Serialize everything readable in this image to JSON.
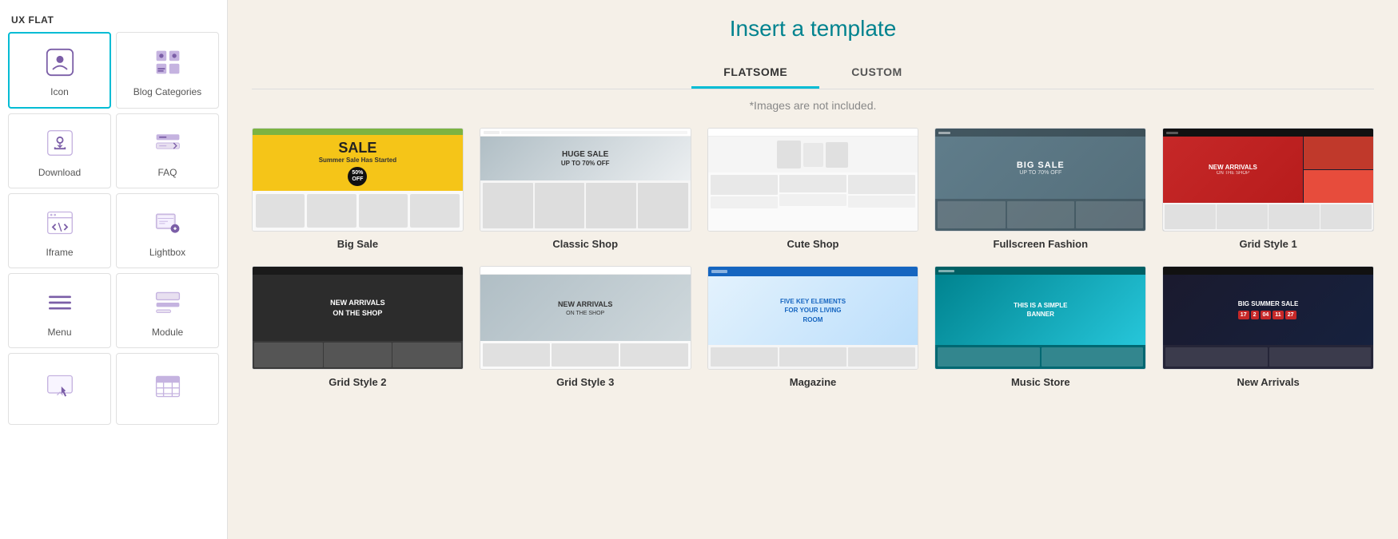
{
  "sidebar": {
    "title": "UX FLAT",
    "items": [
      {
        "id": "icon",
        "label": "Icon",
        "active": true
      },
      {
        "id": "blog-categories",
        "label": "Blog Categories",
        "active": false
      },
      {
        "id": "download",
        "label": "Download",
        "active": false
      },
      {
        "id": "faq",
        "label": "FAQ",
        "active": false
      },
      {
        "id": "iframe",
        "label": "Iframe",
        "active": false
      },
      {
        "id": "lightbox",
        "label": "Lightbox",
        "active": false
      },
      {
        "id": "menu",
        "label": "Menu",
        "active": false
      },
      {
        "id": "module",
        "label": "Module",
        "active": false
      },
      {
        "id": "cursor",
        "label": "",
        "active": false
      },
      {
        "id": "table",
        "label": "",
        "active": false
      }
    ]
  },
  "main": {
    "title": "Insert a template",
    "tabs": [
      {
        "id": "flatsome",
        "label": "FLATSOME",
        "active": true
      },
      {
        "id": "custom",
        "label": "CUSTOM",
        "active": false
      }
    ],
    "subtitle": "*Images are not included.",
    "templates_row1": [
      {
        "id": "big-sale",
        "name": "Big Sale"
      },
      {
        "id": "classic-shop",
        "name": "Classic Shop"
      },
      {
        "id": "cute-shop",
        "name": "Cute Shop"
      },
      {
        "id": "fullscreen-fashion",
        "name": "Fullscreen Fashion"
      },
      {
        "id": "grid-style-1",
        "name": "Grid Style 1"
      }
    ],
    "templates_row2": [
      {
        "id": "template-6",
        "name": "Grid Style 2"
      },
      {
        "id": "template-7",
        "name": "Grid Style 3"
      },
      {
        "id": "template-8",
        "name": "Magazine"
      },
      {
        "id": "template-9",
        "name": "Music Store"
      },
      {
        "id": "template-10",
        "name": "New Arrivals"
      }
    ]
  }
}
